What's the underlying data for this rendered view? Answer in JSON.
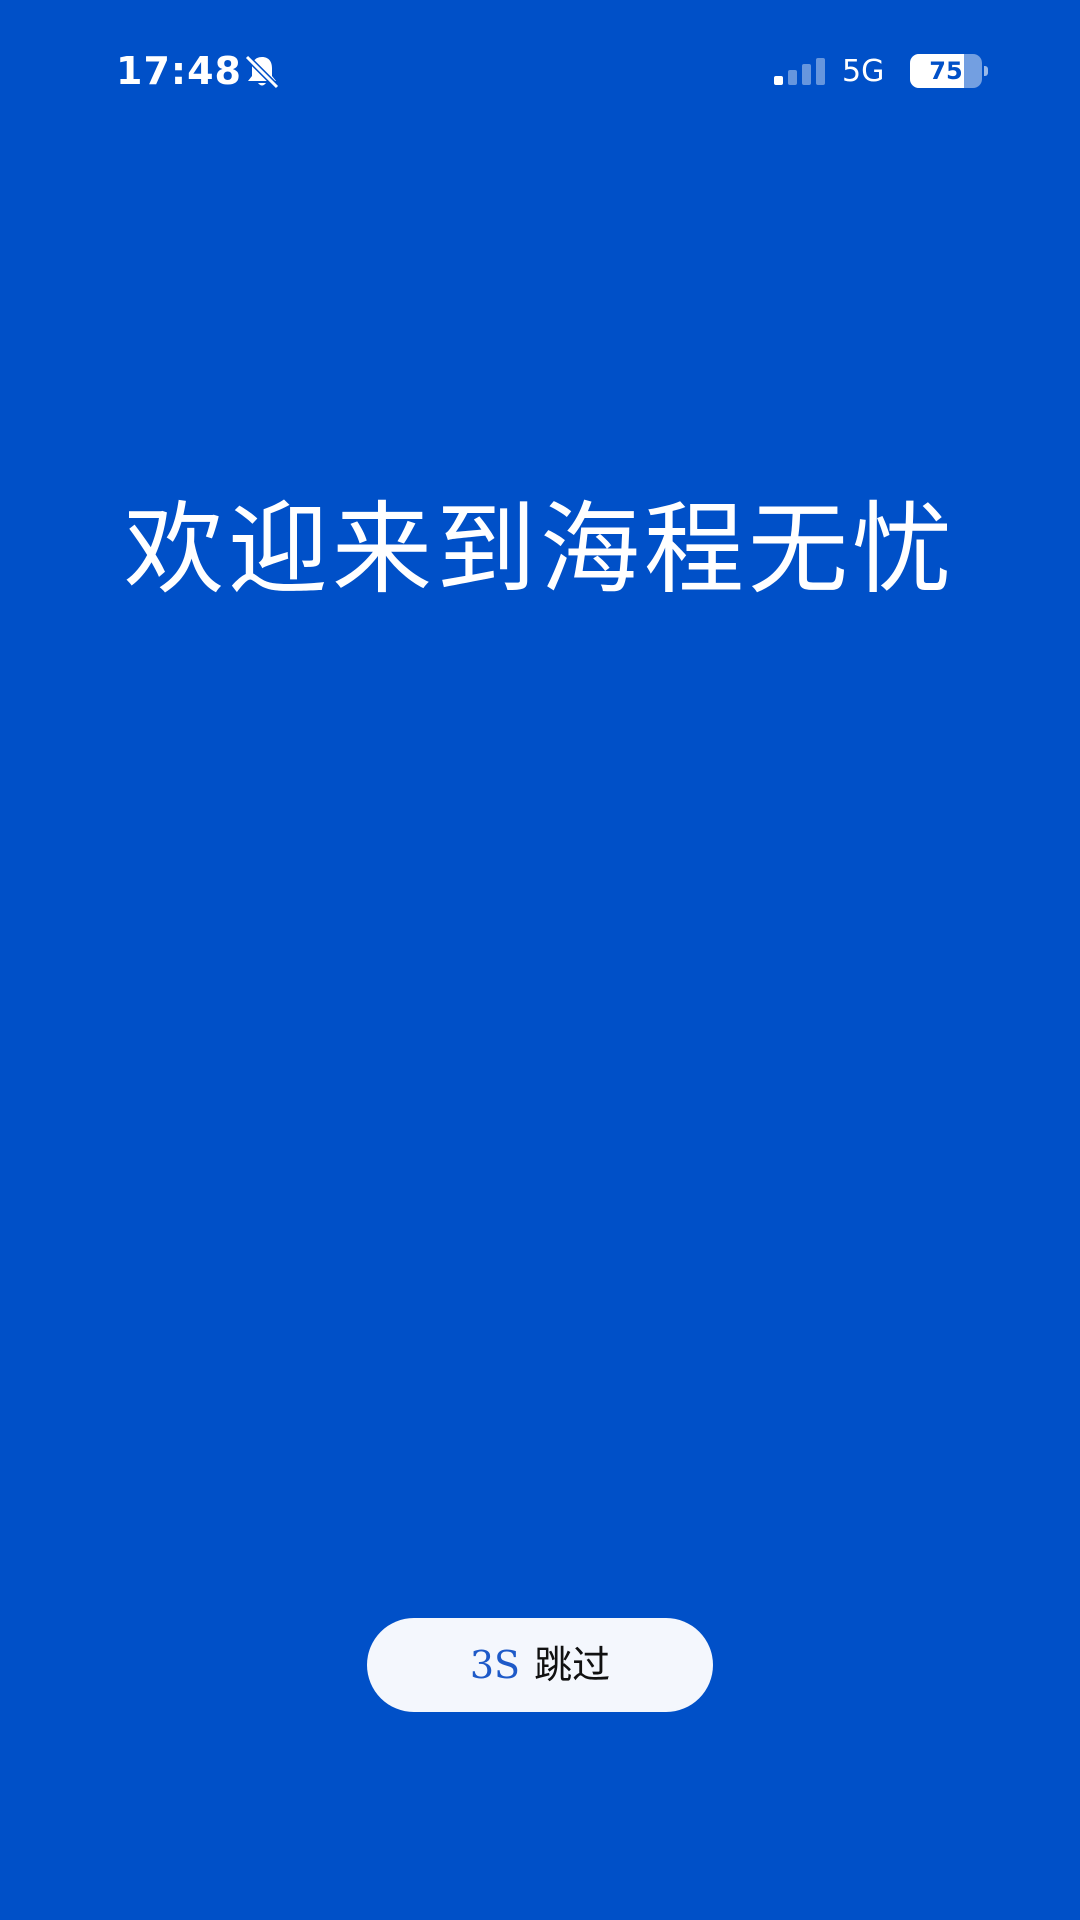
{
  "status_bar": {
    "time": "17:48",
    "mute_icon": "bell-slash-icon",
    "signal_icon": "cellular-signal-icon",
    "signal_bars_active": 1,
    "signal_bars_total": 4,
    "network_type": "5G",
    "battery_level": "75",
    "battery_fraction": 0.75
  },
  "main": {
    "welcome_text": "欢迎来到海程无忧"
  },
  "skip": {
    "countdown": "3S",
    "label": "跳过"
  },
  "colors": {
    "background": "#0050C8",
    "button_background": "#F4F7FD",
    "countdown_text": "#1E5AC8",
    "foreground": "#FFFFFF"
  }
}
